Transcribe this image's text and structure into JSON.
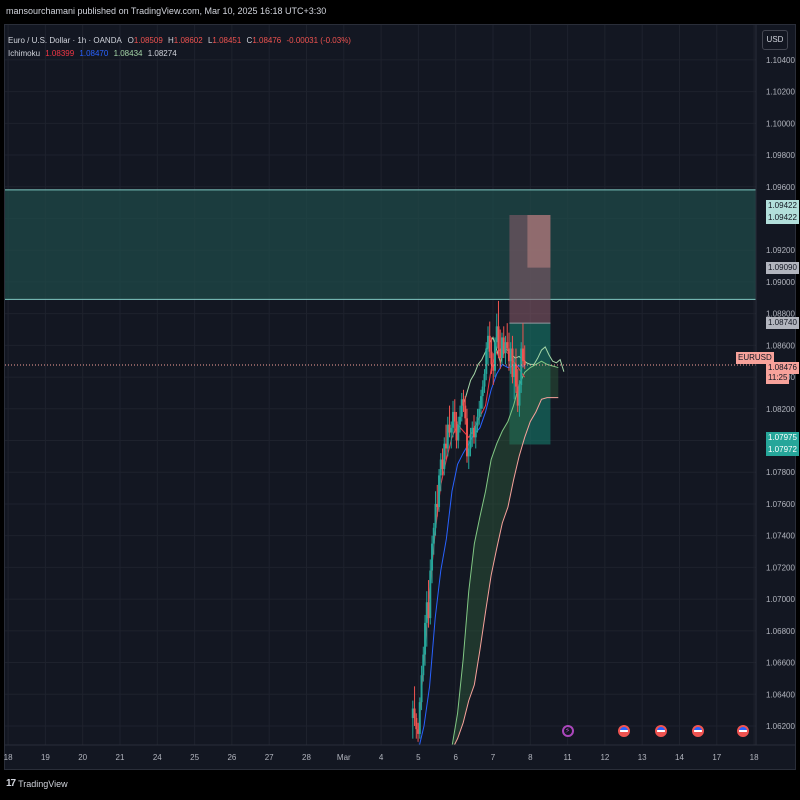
{
  "header": {
    "published_by": "mansourchamani published on TradingView.com, Mar 10, 2025 16:18 UTC+3:30"
  },
  "legend": {
    "symbol_line": "Euro / U.S. Dollar · 1h · OANDA",
    "open_label": "O",
    "open": "1.08509",
    "high_label": "H",
    "high": "1.08602",
    "low_label": "L",
    "low": "1.08451",
    "close_label": "C",
    "close": "1.08476",
    "change": "-0.00031 (-0.03%)",
    "indicator_name": "Ichimoku",
    "ichimoku_values": [
      "1.08399",
      "1.08470",
      "1.08434",
      "1.08274"
    ],
    "ichimoku_colors": [
      "#f23645",
      "#2962ff",
      "#a5d6a7",
      "#d1d4dc"
    ]
  },
  "currency_button": "USD",
  "footer": {
    "brand": "TradingView",
    "brand_mark": "17"
  },
  "colors": {
    "background": "#131722",
    "grid": "#1e222d",
    "up": "#26a69a",
    "down": "#ef5350",
    "zone_fill": "#1f4a48",
    "zone_border": "#80cbc4",
    "tenkan": "#f23645",
    "kijun": "#2962ff",
    "lagging": "#a5d6a7",
    "span_a": "#81c784",
    "span_b": "#f7a29b",
    "stop_box": "#8c5d6b",
    "target_box": "#167a6a"
  },
  "price_tags": [
    {
      "label": "1.09422",
      "bg": "#b2dfdb",
      "fg": "#131722"
    },
    {
      "label": "1.09422",
      "bg": "#b2dfdb",
      "fg": "#131722"
    },
    {
      "label": "1.09090",
      "bg": "#b2b5be",
      "fg": "#131722"
    },
    {
      "label": "1.08740",
      "bg": "#b2b5be",
      "fg": "#131722"
    },
    {
      "label": "EURUSD",
      "bg": "#f7a29b",
      "fg": "#131722"
    },
    {
      "label": "1.08476",
      "bg": "#f7a29b",
      "fg": "#131722"
    },
    {
      "label": "11:25",
      "bg": "#f7a29b",
      "fg": "#131722"
    },
    {
      "label": "1.07975",
      "bg": "#26a69a",
      "fg": "#ffffff"
    },
    {
      "label": "1.07972",
      "bg": "#26a69a",
      "fg": "#ffffff"
    }
  ],
  "events": [
    {
      "icon": "lightning-icon",
      "date": 10
    },
    {
      "icon": "us-flag-icon",
      "date": 11.5
    },
    {
      "icon": "us-flag-icon",
      "date": 12.5
    },
    {
      "icon": "us-flag-icon",
      "date": 13.5
    },
    {
      "icon": "us-flag-icon",
      "date": 14.7
    }
  ],
  "chart_data": {
    "type": "candlestick",
    "symbol": "Euro / U.S. Dollar",
    "timeframe": "1h",
    "exchange": "OANDA",
    "x_ticks": [
      {
        "label": "18",
        "pos": -13
      },
      {
        "label": "19",
        "pos": -12
      },
      {
        "label": "20",
        "pos": -11
      },
      {
        "label": "21",
        "pos": -10
      },
      {
        "label": "24",
        "pos": -9
      },
      {
        "label": "25",
        "pos": -8
      },
      {
        "label": "26",
        "pos": -7
      },
      {
        "label": "27",
        "pos": -6
      },
      {
        "label": "28",
        "pos": -5
      },
      {
        "label": "Mar",
        "pos": -4
      },
      {
        "label": "4",
        "pos": -3
      },
      {
        "label": "5",
        "pos": -2
      },
      {
        "label": "6",
        "pos": -1
      },
      {
        "label": "7",
        "pos": 0
      },
      {
        "label": "8",
        "pos": 1
      },
      {
        "label": "11",
        "pos": 2
      },
      {
        "label": "12",
        "pos": 3
      },
      {
        "label": "13",
        "pos": 4
      },
      {
        "label": "14",
        "pos": 5
      },
      {
        "label": "17",
        "pos": 6
      },
      {
        "label": "18",
        "pos": 7
      }
    ],
    "y_ticks": [
      1.104,
      1.102,
      1.1,
      1.098,
      1.096,
      1.094,
      1.092,
      1.09,
      1.088,
      1.086,
      1.084,
      1.082,
      1.08,
      1.078,
      1.076,
      1.074,
      1.072,
      1.07,
      1.068,
      1.066,
      1.064,
      1.062
    ],
    "ylim": [
      1.0608,
      1.1062
    ],
    "last_price": 1.08476,
    "supply_zone": {
      "top": 1.0958,
      "bottom": 1.0889
    },
    "position": {
      "entry": 1.0874,
      "stop": 1.09422,
      "partial": 1.0909,
      "target": 1.07975,
      "start_pos": 0.44,
      "end_pos": 1.54
    },
    "candles": [
      [
        1.0625,
        1.0636,
        1.0612,
        1.0631
      ],
      [
        1.0631,
        1.0645,
        1.062,
        1.0625
      ],
      [
        1.0625,
        1.0628,
        1.0612,
        1.0618
      ],
      [
        1.0618,
        1.0622,
        1.061,
        1.0615
      ],
      [
        1.0615,
        1.0638,
        1.0612,
        1.0635
      ],
      [
        1.0635,
        1.0658,
        1.063,
        1.0652
      ],
      [
        1.0652,
        1.067,
        1.0648,
        1.0665
      ],
      [
        1.0665,
        1.069,
        1.0658,
        1.0685
      ],
      [
        1.0685,
        1.0705,
        1.067,
        1.0698
      ],
      [
        1.0698,
        1.0712,
        1.0682,
        1.0688
      ],
      [
        1.0688,
        1.0725,
        1.0684,
        1.0718
      ],
      [
        1.0718,
        1.074,
        1.071,
        1.0735
      ],
      [
        1.0735,
        1.0748,
        1.0728,
        1.0745
      ],
      [
        1.0745,
        1.0768,
        1.074,
        1.076
      ],
      [
        1.076,
        1.0772,
        1.0752,
        1.0758
      ],
      [
        1.0758,
        1.0782,
        1.0755,
        1.0778
      ],
      [
        1.0778,
        1.0792,
        1.0768,
        1.0788
      ],
      [
        1.0788,
        1.0795,
        1.0778,
        1.0782
      ],
      [
        1.0782,
        1.0802,
        1.0778,
        1.0798
      ],
      [
        1.0798,
        1.081,
        1.0788,
        1.0795
      ],
      [
        1.0795,
        1.0815,
        1.079,
        1.081
      ],
      [
        1.081,
        1.0822,
        1.0802,
        1.0805
      ],
      [
        1.0805,
        1.0812,
        1.0795,
        1.0808
      ],
      [
        1.0808,
        1.0825,
        1.0802,
        1.0818
      ],
      [
        1.0818,
        1.0826,
        1.0805,
        1.0812
      ],
      [
        1.0812,
        1.0818,
        1.0795,
        1.08
      ],
      [
        1.08,
        1.0815,
        1.0795,
        1.081
      ],
      [
        1.081,
        1.0822,
        1.0805,
        1.0815
      ],
      [
        1.0815,
        1.083,
        1.0812,
        1.0826
      ],
      [
        1.0826,
        1.0832,
        1.0818,
        1.0822
      ],
      [
        1.0822,
        1.0828,
        1.081,
        1.0814
      ],
      [
        1.0814,
        1.082,
        1.0786,
        1.079
      ],
      [
        1.079,
        1.08,
        1.0782,
        1.0795
      ],
      [
        1.0795,
        1.0808,
        1.079,
        1.0804
      ],
      [
        1.0804,
        1.0812,
        1.0796,
        1.0808
      ],
      [
        1.0808,
        1.0816,
        1.0798,
        1.0802
      ],
      [
        1.0802,
        1.0812,
        1.0795,
        1.0809
      ],
      [
        1.0809,
        1.082,
        1.0805,
        1.0815
      ],
      [
        1.0815,
        1.0825,
        1.081,
        1.082
      ],
      [
        1.082,
        1.0832,
        1.0815,
        1.0828
      ],
      [
        1.0828,
        1.0838,
        1.082,
        1.0834
      ],
      [
        1.0834,
        1.0845,
        1.083,
        1.0842
      ],
      [
        1.0842,
        1.0862,
        1.0838,
        1.0858
      ],
      [
        1.0858,
        1.0872,
        1.0848,
        1.0866
      ],
      [
        1.0866,
        1.0875,
        1.0852,
        1.0856
      ],
      [
        1.0856,
        1.0865,
        1.0842,
        1.0848
      ],
      [
        1.0848,
        1.0855,
        1.0835,
        1.0844
      ],
      [
        1.0844,
        1.0865,
        1.084,
        1.0862
      ],
      [
        1.0862,
        1.088,
        1.0858,
        1.0872
      ],
      [
        1.0872,
        1.0888,
        1.0852,
        1.0858
      ],
      [
        1.0858,
        1.087,
        1.0845,
        1.0852
      ],
      [
        1.0852,
        1.0868,
        1.0848,
        1.0865
      ],
      [
        1.0865,
        1.0872,
        1.0852,
        1.0855
      ],
      [
        1.0855,
        1.0866,
        1.0848,
        1.0862
      ],
      [
        1.0862,
        1.0874,
        1.0856,
        1.0858
      ],
      [
        1.0858,
        1.0868,
        1.0844,
        1.085
      ],
      [
        1.085,
        1.0862,
        1.0842,
        1.0858
      ],
      [
        1.0858,
        1.0866,
        1.0836,
        1.084
      ],
      [
        1.084,
        1.0852,
        1.0826,
        1.0848
      ],
      [
        1.0848,
        1.0858,
        1.083,
        1.0834
      ],
      [
        1.0834,
        1.0845,
        1.0818,
        1.0822
      ],
      [
        1.0822,
        1.0838,
        1.0815,
        1.0835
      ],
      [
        1.0835,
        1.0862,
        1.083,
        1.0858
      ],
      [
        1.0858,
        1.0874,
        1.0846,
        1.085
      ],
      [
        1.085,
        1.086,
        1.0845,
        1.08476
      ]
    ],
    "ichimoku": {
      "tenkan": [
        [
          -2.0,
          1.0615
        ],
        [
          -1.85,
          1.0662
        ],
        [
          -1.7,
          1.0705
        ],
        [
          -1.55,
          1.0742
        ],
        [
          -1.4,
          1.0772
        ],
        [
          -1.25,
          1.0788
        ],
        [
          -1.1,
          1.0802
        ],
        [
          -0.95,
          1.081
        ],
        [
          -0.8,
          1.0806
        ],
        [
          -0.65,
          1.0802
        ],
        [
          -0.5,
          1.0808
        ],
        [
          -0.35,
          1.0815
        ],
        [
          -0.2,
          1.0822
        ],
        [
          -0.05,
          1.0845
        ],
        [
          0.1,
          1.0856
        ],
        [
          0.25,
          1.0858
        ],
        [
          0.4,
          1.0855
        ],
        [
          0.55,
          1.085
        ],
        [
          0.7,
          1.0845
        ],
        [
          0.85,
          1.08399
        ]
      ],
      "kijun": [
        [
          -2.0,
          1.0605
        ],
        [
          -1.85,
          1.062
        ],
        [
          -1.7,
          1.0645
        ],
        [
          -1.55,
          1.0688
        ],
        [
          -1.4,
          1.0718
        ],
        [
          -1.25,
          1.0738
        ],
        [
          -1.1,
          1.0768
        ],
        [
          -0.95,
          1.0785
        ],
        [
          -0.8,
          1.0792
        ],
        [
          -0.65,
          1.0798
        ],
        [
          -0.5,
          1.0804
        ],
        [
          -0.35,
          1.0808
        ],
        [
          -0.2,
          1.0818
        ],
        [
          -0.05,
          1.0832
        ],
        [
          0.1,
          1.0842
        ],
        [
          0.25,
          1.0848
        ],
        [
          0.4,
          1.0846
        ],
        [
          0.55,
          1.0847
        ],
        [
          0.7,
          1.0847
        ],
        [
          0.85,
          1.0847
        ]
      ],
      "chikou": [
        [
          -0.8,
          1.0822
        ],
        [
          -0.7,
          1.083
        ],
        [
          -0.6,
          1.0838
        ],
        [
          -0.5,
          1.0842
        ],
        [
          -0.4,
          1.0848
        ],
        [
          -0.3,
          1.0851
        ],
        [
          -0.2,
          1.0856
        ],
        [
          -0.1,
          1.0861
        ],
        [
          0.0,
          1.0865
        ],
        [
          0.1,
          1.0857
        ],
        [
          0.2,
          1.0849
        ],
        [
          0.3,
          1.0858
        ],
        [
          0.4,
          1.0857
        ],
        [
          0.5,
          1.0854
        ],
        [
          0.6,
          1.0852
        ],
        [
          0.7,
          1.0853
        ],
        [
          0.8,
          1.0851
        ],
        [
          0.9,
          1.0849
        ],
        [
          1.0,
          1.0848
        ],
        [
          1.1,
          1.0848
        ],
        [
          1.2,
          1.0852
        ],
        [
          1.3,
          1.0857
        ],
        [
          1.4,
          1.0859
        ],
        [
          1.5,
          1.0854
        ],
        [
          1.6,
          1.085
        ],
        [
          1.7,
          1.0849
        ],
        [
          1.8,
          1.0851
        ],
        [
          1.9,
          1.08434
        ]
      ],
      "span_a": [
        [
          -1.1,
          1.0607
        ],
        [
          -0.95,
          1.0628
        ],
        [
          -0.8,
          1.0662
        ],
        [
          -0.65,
          1.0705
        ],
        [
          -0.5,
          1.0735
        ],
        [
          -0.35,
          1.0752
        ],
        [
          -0.2,
          1.0768
        ],
        [
          -0.05,
          1.0788
        ],
        [
          0.1,
          1.0798
        ],
        [
          0.25,
          1.0806
        ],
        [
          0.4,
          1.0812
        ],
        [
          0.55,
          1.0822
        ],
        [
          0.7,
          1.0835
        ],
        [
          0.85,
          1.0843
        ],
        [
          1.0,
          1.0846
        ],
        [
          1.15,
          1.0848
        ],
        [
          1.3,
          1.085
        ],
        [
          1.45,
          1.0848
        ],
        [
          1.6,
          1.0847
        ],
        [
          1.75,
          1.0846
        ]
      ],
      "span_b": [
        [
          -1.1,
          1.0605
        ],
        [
          -0.95,
          1.0612
        ],
        [
          -0.8,
          1.0622
        ],
        [
          -0.65,
          1.0636
        ],
        [
          -0.5,
          1.0646
        ],
        [
          -0.35,
          1.0668
        ],
        [
          -0.2,
          1.0692
        ],
        [
          -0.05,
          1.0715
        ],
        [
          0.1,
          1.0732
        ],
        [
          0.25,
          1.0748
        ],
        [
          0.4,
          1.0758
        ],
        [
          0.55,
          1.0775
        ],
        [
          0.7,
          1.079
        ],
        [
          0.85,
          1.0802
        ],
        [
          1.0,
          1.0812
        ],
        [
          1.15,
          1.0818
        ],
        [
          1.3,
          1.0826
        ],
        [
          1.45,
          1.0827
        ],
        [
          1.6,
          1.0827
        ],
        [
          1.75,
          1.0827
        ]
      ]
    }
  }
}
